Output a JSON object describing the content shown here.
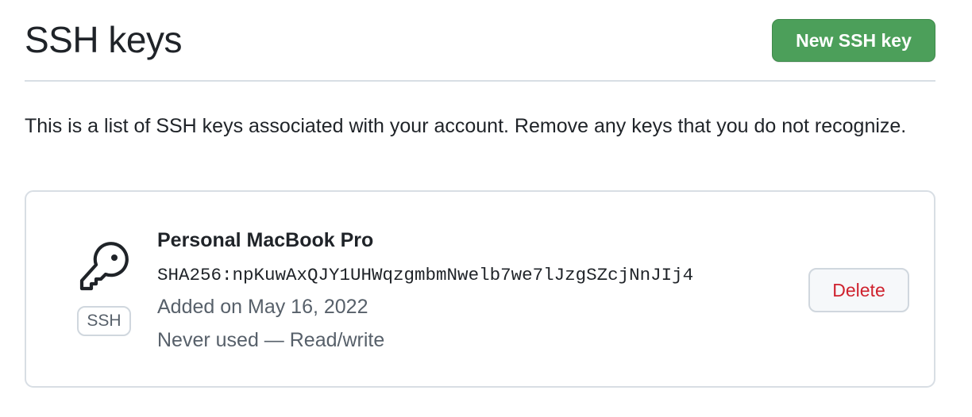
{
  "header": {
    "title": "SSH keys",
    "new_key_label": "New SSH key"
  },
  "description": "This is a list of SSH keys associated with your account. Remove any keys that you do not recognize.",
  "keys": [
    {
      "title": "Personal MacBook Pro",
      "fingerprint": "SHA256:npKuwAxQJY1UHWqzgmbmNwelb7we7lJzgSZcjNnJIj4",
      "added": "Added on May 16, 2022",
      "usage": "Never used — Read/write",
      "badge": "SSH",
      "icon": "key-icon",
      "delete_label": "Delete"
    }
  ],
  "colors": {
    "primary_button": "#4c9f5a",
    "danger_text": "#cf222e",
    "border": "#d8dee4",
    "muted_text": "#57606a"
  }
}
